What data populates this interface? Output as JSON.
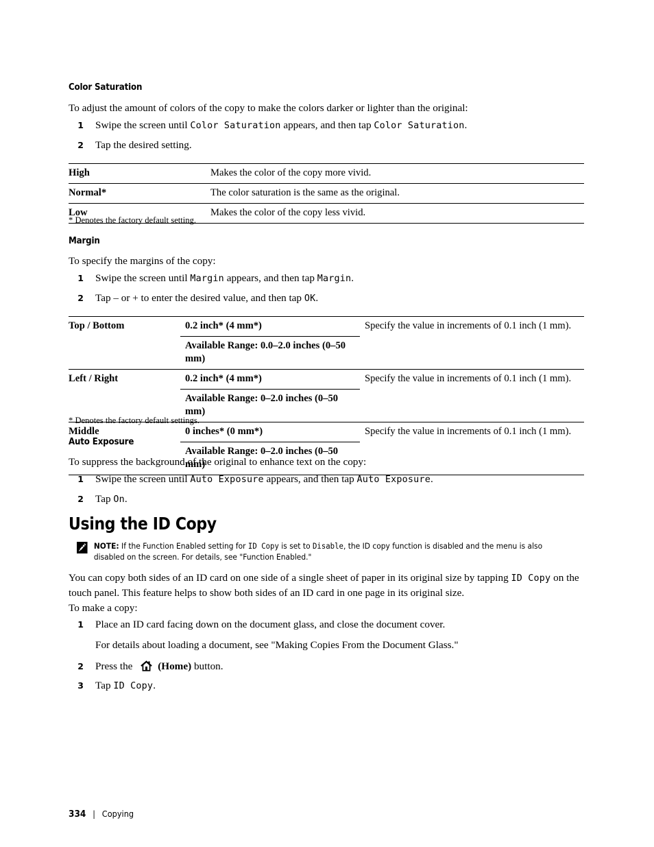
{
  "sections": {
    "color_saturation": {
      "heading": "Color Saturation",
      "intro": "To adjust the amount of colors of the copy to make the colors darker or lighter than the original:",
      "steps": [
        {
          "num": "1",
          "pre": "Swipe the screen until ",
          "mono1": "Color Saturation",
          "mid": " appears, and then tap ",
          "mono2": "Color Saturation",
          "post": "."
        },
        {
          "num": "2",
          "pre": "Tap the desired setting.",
          "mono1": "",
          "mid": "",
          "mono2": "",
          "post": ""
        }
      ],
      "table": {
        "rows": [
          {
            "label": "High",
            "desc": "Makes the color of the copy more vivid."
          },
          {
            "label": "Normal*",
            "desc": "The color saturation is the same as the original."
          },
          {
            "label": "Low",
            "desc": "Makes the color of the copy less vivid."
          }
        ]
      },
      "footnote": "* Denotes the factory default setting."
    },
    "margin": {
      "heading": "Margin",
      "intro": "To specify the margins of the copy:",
      "steps": [
        {
          "num": "1",
          "pre": "Swipe the screen until ",
          "mono1": "Margin",
          "mid": " appears, and then tap ",
          "mono2": "Margin",
          "post": "."
        },
        {
          "num": "2",
          "pre": "Tap – or + to enter the desired value, and then tap ",
          "mono1": "OK",
          "mid": "",
          "mono2": "",
          "post": "."
        }
      ],
      "table": {
        "rows": [
          {
            "label": "Top / Bottom",
            "value": "0.2 inch* (4 mm*)",
            "range": "Available Range: 0.0–2.0 inches (0–50 mm)",
            "desc": "Specify the value in increments of 0.1 inch (1 mm)."
          },
          {
            "label": "Left / Right",
            "value": "0.2 inch* (4 mm*)",
            "range": "Available Range: 0–2.0 inches (0–50 mm)",
            "desc": "Specify the value in increments of 0.1 inch (1 mm)."
          },
          {
            "label": "Middle",
            "value": "0 inches* (0 mm*)",
            "range": "Available Range: 0–2.0 inches (0–50 mm)",
            "desc": "Specify the value in increments of 0.1 inch (1 mm)."
          }
        ]
      },
      "footnote": "* Denotes the factory default settings."
    },
    "auto_exposure": {
      "heading": "Auto Exposure",
      "intro": "To suppress the background of the original to enhance text on the copy:",
      "steps": [
        {
          "num": "1",
          "pre": "Swipe the screen until ",
          "mono1": "Auto Exposure",
          "mid": " appears, and then tap ",
          "mono2": "Auto Exposure",
          "post": "."
        },
        {
          "num": "2",
          "pre": "Tap ",
          "mono1": "On",
          "mid": "",
          "mono2": "",
          "post": "."
        }
      ]
    },
    "id_copy": {
      "heading": "Using the ID Copy",
      "note": {
        "icon": "note-pencil-icon",
        "lead": "NOTE:",
        "t1": " If the Function Enabled setting for ",
        "mono1": "ID Copy",
        "t2": " is set to ",
        "mono2": "Disable",
        "t3": ", the ID copy function is disabled and the menu is also disabled on the screen. For details, see \"Function Enabled.\""
      },
      "para1_a": "You can copy both sides of an ID card on one side of a single sheet of paper in its original size by tapping ",
      "para1_mono": "ID Copy",
      "para1_b": " on the touch panel. This feature helps to show both sides of an ID card in one page in its original size.",
      "para2": "To make a copy:",
      "steps": [
        {
          "num": "1",
          "text": "Place an ID card facing down on the document glass, and close the document cover.",
          "sub": "For details about loading a document, see \"Making Copies From the Document Glass.\""
        },
        {
          "num": "2",
          "pre": "Press the ",
          "icon": "home-icon",
          "bold": "(Home)",
          "post": " button."
        },
        {
          "num": "3",
          "pre": "Tap ",
          "mono": "ID Copy",
          "post": "."
        }
      ]
    }
  },
  "footer": {
    "page_number": "334",
    "separator": "|",
    "chapter": "Copying"
  },
  "colors": {
    "text": "#000000",
    "background": "#ffffff",
    "rule": "#000000"
  }
}
